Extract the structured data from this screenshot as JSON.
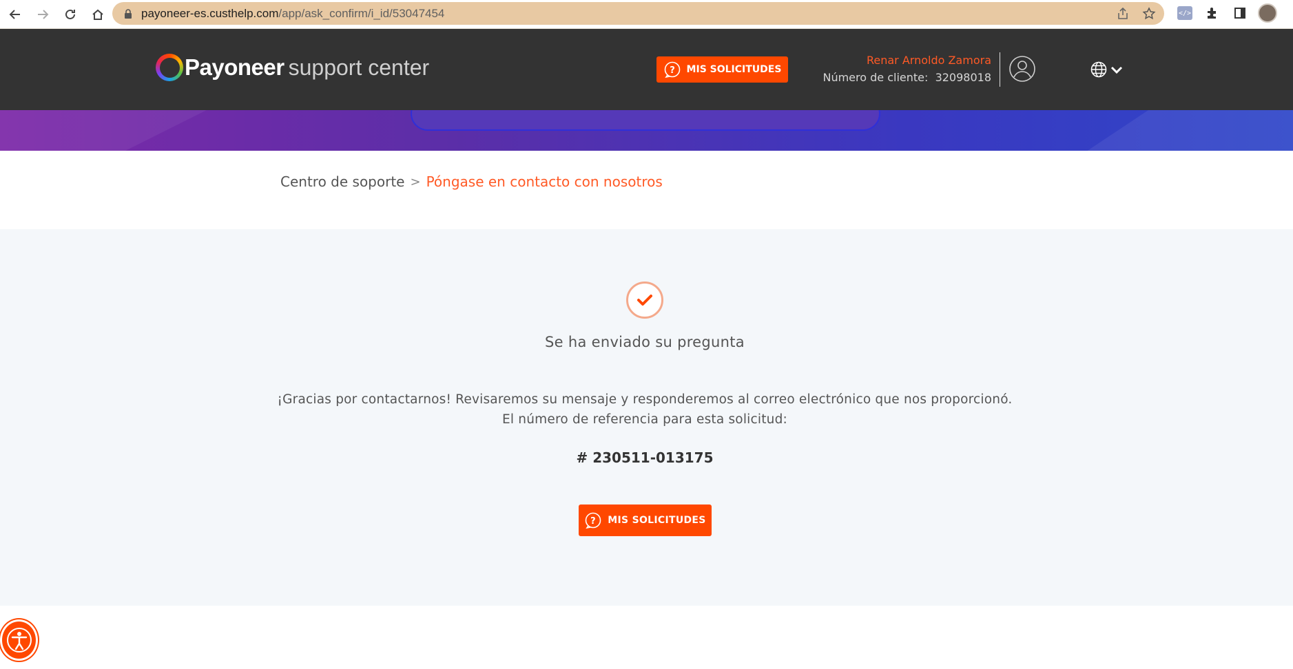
{
  "browser": {
    "url_host": "payoneer-es.custhelp.com",
    "url_path": "/app/ask_confirm/i_id/53047454"
  },
  "header": {
    "logo_brand": "Payoneer",
    "logo_sub": "support center",
    "my_requests_label": "MIS SOLICITUDES",
    "user_name": "Renar Arnoldo Zamora",
    "customer_number_label": "Número de cliente:",
    "customer_number": "32098018"
  },
  "breadcrumb": {
    "home": "Centro de soporte",
    "separator": ">",
    "current": "Póngase en contacto con nosotros"
  },
  "confirmation": {
    "title": "Se ha enviado su pregunta",
    "message_line1": "¡Gracias por contactarnos! Revisaremos su mensaje y responderemos al correo electrónico que nos proporcionó.",
    "message_line2": "El número de referencia para esta solicitud:",
    "reference": "# 230511-013175",
    "button_label": "MIS SOLICITUDES"
  },
  "colors": {
    "accent": "#ff4800",
    "header_bg": "#333333",
    "panel_bg": "#f4f7fa",
    "address_bar": "#e8c9a3"
  },
  "icons": [
    "back-icon",
    "forward-icon",
    "reload-icon",
    "home-icon",
    "lock-icon",
    "share-icon",
    "star-icon",
    "extensions-icon",
    "sidepanel-icon",
    "question-bubble-icon",
    "user-icon",
    "globe-icon",
    "chevron-down-icon",
    "checkmark-icon",
    "search-icon",
    "accessibility-icon"
  ]
}
